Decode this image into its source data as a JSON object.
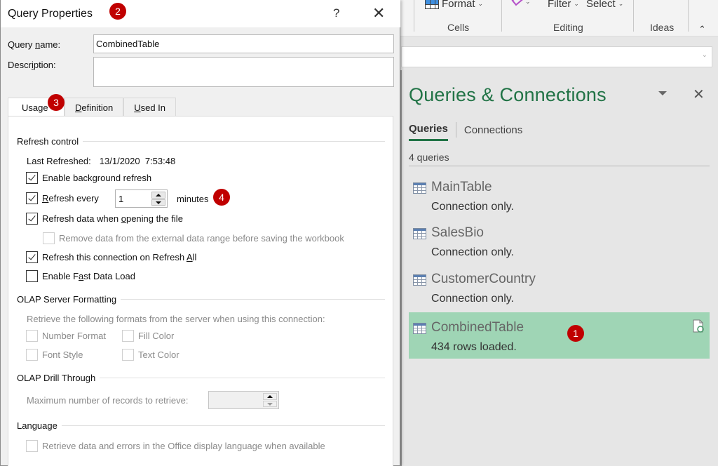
{
  "ribbon": {
    "cells_cmd": "Format",
    "editing_cmds": [
      "Filter",
      "Select"
    ],
    "groups": [
      "Cells",
      "Editing",
      "Ideas"
    ]
  },
  "dialog": {
    "title": "Query Properties",
    "help_label": "?",
    "close_label": "✕",
    "query_name_label_pre": "Query ",
    "query_name_label_u": "n",
    "query_name_label_post": "ame:",
    "query_name_value": "CombinedTable",
    "description_label_pre": "Descr",
    "description_label_u": "i",
    "description_label_post": "ption:",
    "description_value": "",
    "tabs": [
      {
        "label": "Usage",
        "active": true
      },
      {
        "label_u": "D",
        "label_rest": "efinition",
        "active": false
      },
      {
        "label_u": "U",
        "label_rest": "sed In",
        "active": false
      }
    ],
    "usage": {
      "refresh_control_title": "Refresh control",
      "last_refreshed_label": "Last Refreshed:",
      "last_refreshed_value": "13/1/2020  7:53:48",
      "enable_background_refresh": {
        "pre": "Enable back",
        "u": "g",
        "post": "round refresh",
        "checked": true
      },
      "refresh_every": {
        "pre": "",
        "u": "R",
        "post": "efresh every",
        "checked": true,
        "value": "1",
        "unit": "minutes"
      },
      "refresh_on_open": {
        "pre": "Refresh data when ",
        "u": "o",
        "post": "pening the file",
        "checked": true
      },
      "remove_data": {
        "label": "Remove data from the external data range before saving the workbook",
        "checked": false,
        "disabled": true
      },
      "refresh_all": {
        "pre": "Refresh this connection on Refresh ",
        "u": "A",
        "post": "ll",
        "checked": true
      },
      "fast_load": {
        "pre": "Enable F",
        "u": "a",
        "post": "st Data Load",
        "checked": false
      },
      "olap_formatting_title": "OLAP Server Formatting",
      "olap_formatting_desc": "Retrieve the following formats from the server when using this connection:",
      "olap_formats": [
        {
          "label": "Number Format",
          "checked": false
        },
        {
          "label": "Fill Color",
          "checked": false
        },
        {
          "label": "Font Style",
          "checked": false
        },
        {
          "label": "Text Color",
          "checked": false
        }
      ],
      "olap_drill_title": "OLAP Drill Through",
      "max_records_label": "Maximum number of records to retrieve:",
      "max_records_value": "",
      "language_title": "Language",
      "language_option": {
        "label": "Retrieve data and errors in the Office display language when available",
        "checked": false
      }
    }
  },
  "pane": {
    "title": "Queries & Connections",
    "tabs": [
      "Queries",
      "Connections"
    ],
    "active_tab": "Queries",
    "count": "4 queries",
    "queries": [
      {
        "name": "MainTable",
        "status": "Connection only.",
        "selected": false
      },
      {
        "name": "SalesBio",
        "status": "Connection only.",
        "selected": false
      },
      {
        "name": "CustomerCountry",
        "status": "Connection only.",
        "selected": false
      },
      {
        "name": "CombinedTable",
        "status": "434 rows loaded.",
        "selected": true
      }
    ]
  },
  "annotations": [
    "1",
    "2",
    "3",
    "4"
  ],
  "colors": {
    "accent_green": "#217346",
    "selected_row": "#9fd5b5",
    "badge_red": "#c00000"
  }
}
